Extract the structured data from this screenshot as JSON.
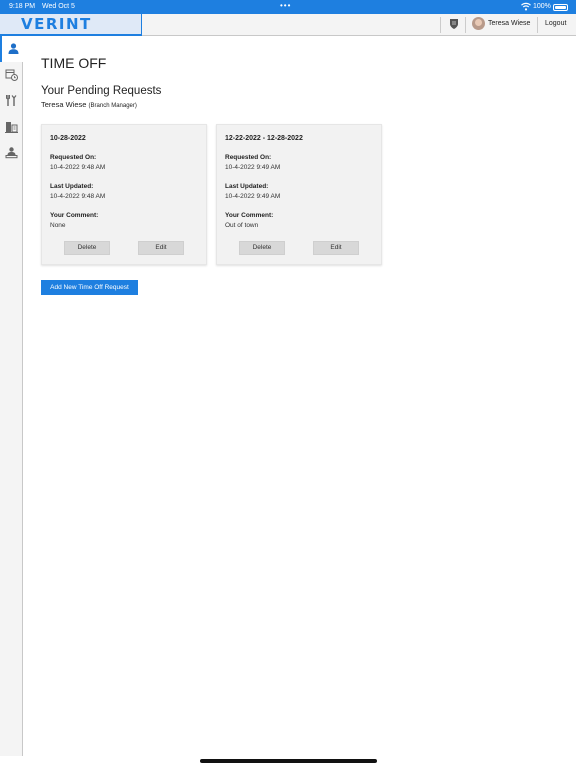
{
  "status_bar": {
    "time": "9:18 PM",
    "date": "Wed Oct 5",
    "multitask_dots": "•••",
    "battery_percent": "100%"
  },
  "header": {
    "brand": "VERINT",
    "user_name": "Teresa Wiese",
    "logout_label": "Logout"
  },
  "colors": {
    "accent": "#1e7fe0",
    "card_bg": "#f2f2f2",
    "button_bg": "#d8d8d8"
  },
  "sidebar": {
    "items": [
      {
        "icon": "person-icon",
        "active": true
      },
      {
        "icon": "calendar-clock-icon",
        "active": false
      },
      {
        "icon": "tools-icon",
        "active": false
      },
      {
        "icon": "building-icon",
        "active": false
      },
      {
        "icon": "person-desk-icon",
        "active": false
      }
    ]
  },
  "main": {
    "page_title": "TIME OFF",
    "section_title": "Your Pending Requests",
    "user_name": "Teresa Wiese",
    "user_role": "(Branch Manager)",
    "requests": [
      {
        "dates": "10-28-2022",
        "requested_on_label": "Requested On:",
        "requested_on": "10-4-2022 9:48 AM",
        "last_updated_label": "Last Updated:",
        "last_updated": "10-4-2022 9:48 AM",
        "comment_label": "Your Comment:",
        "comment": "None",
        "delete_label": "Delete",
        "edit_label": "Edit"
      },
      {
        "dates": "12-22-2022 - 12-28-2022",
        "requested_on_label": "Requested On:",
        "requested_on": "10-4-2022 9:49 AM",
        "last_updated_label": "Last Updated:",
        "last_updated": "10-4-2022 9:49 AM",
        "comment_label": "Your Comment:",
        "comment": "Out of town",
        "delete_label": "Delete",
        "edit_label": "Edit"
      }
    ],
    "add_request_label": "Add New Time Off Request"
  }
}
